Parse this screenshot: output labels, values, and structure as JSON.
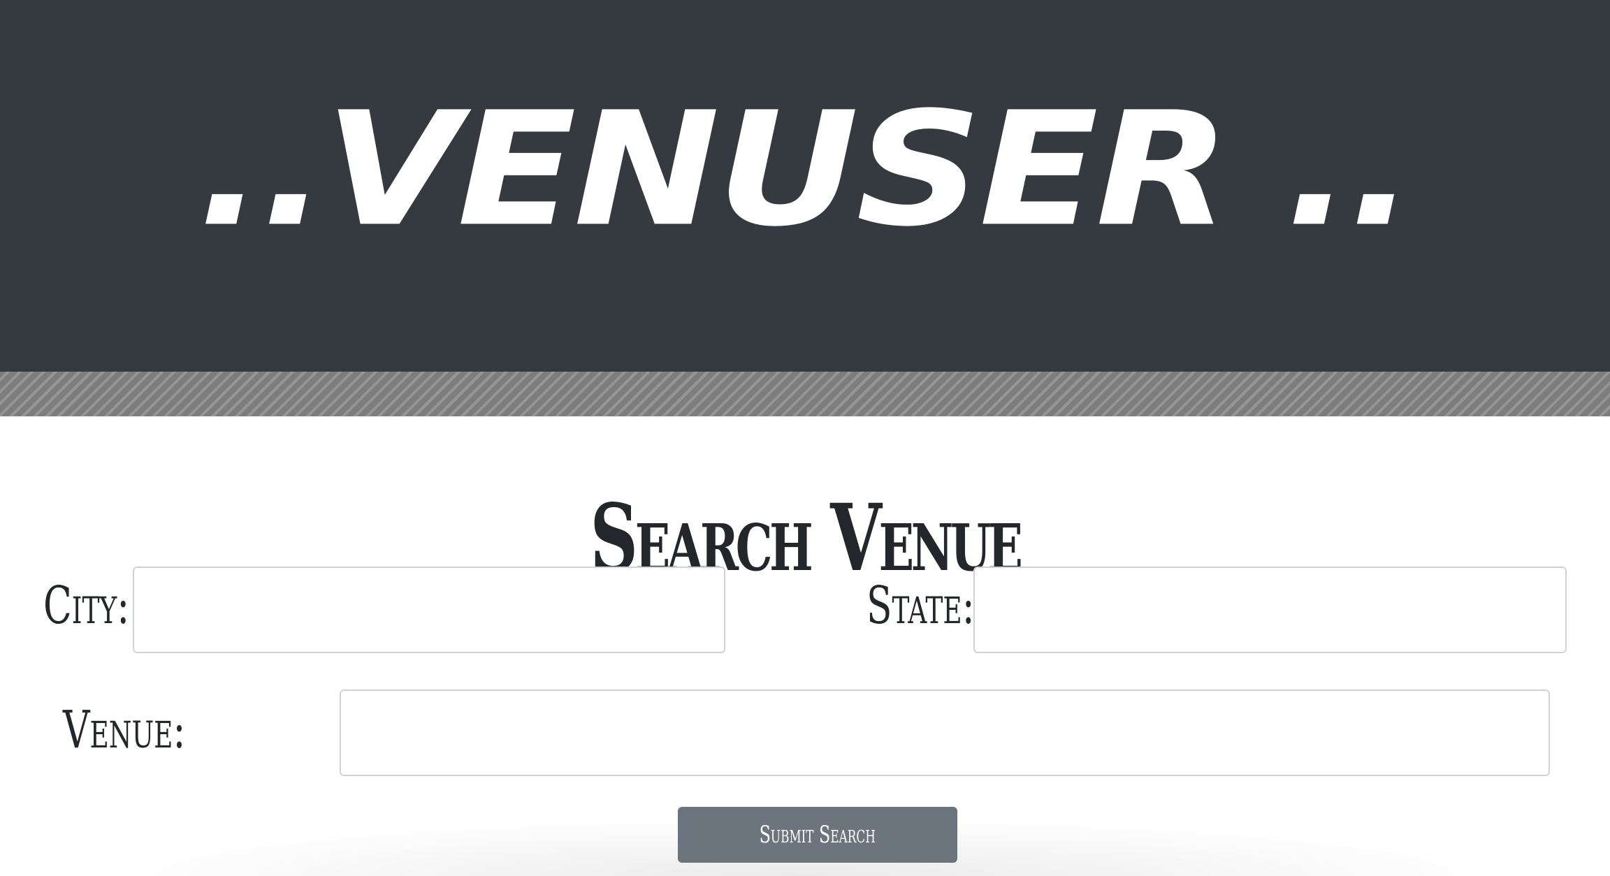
{
  "header": {
    "logo_text": "..VENUSER ..",
    "background": "#343a40"
  },
  "search": {
    "title": "Search Venue",
    "city_label": "City:",
    "city_value": "",
    "state_label": "State:",
    "state_value": "",
    "venue_label": "Venue:",
    "venue_value": "",
    "submit_label": "Submit Search"
  },
  "colors": {
    "header": "#343a40",
    "stripe": "#7d7d7d",
    "button": "#6c757d",
    "text": "#23272b"
  }
}
